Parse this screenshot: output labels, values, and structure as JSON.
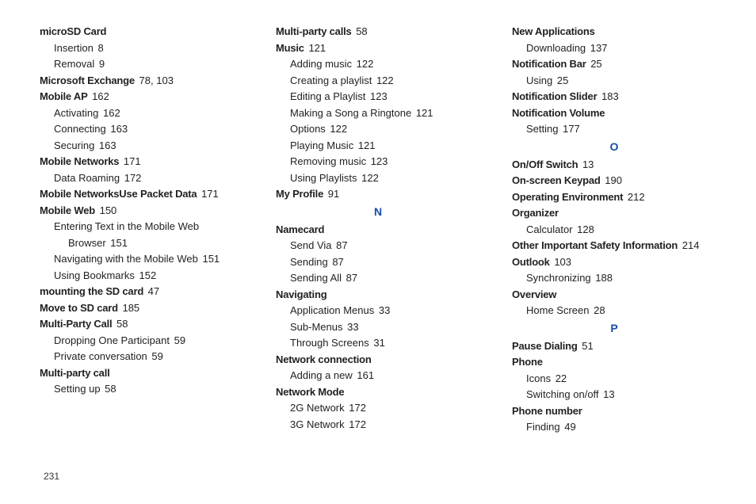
{
  "page_number": "231",
  "columns": [
    [
      {
        "type": "entry",
        "lvl": 0,
        "bold": true,
        "text": "microSD Card",
        "page": ""
      },
      {
        "type": "entry",
        "lvl": 1,
        "bold": false,
        "text": "Insertion",
        "page": "8"
      },
      {
        "type": "entry",
        "lvl": 1,
        "bold": false,
        "text": "Removal",
        "page": "9"
      },
      {
        "type": "entry",
        "lvl": 0,
        "bold": true,
        "text": "Microsoft Exchange",
        "page": "78, 103"
      },
      {
        "type": "entry",
        "lvl": 0,
        "bold": true,
        "text": "Mobile AP",
        "page": "162"
      },
      {
        "type": "entry",
        "lvl": 1,
        "bold": false,
        "text": "Activating",
        "page": "162"
      },
      {
        "type": "entry",
        "lvl": 1,
        "bold": false,
        "text": "Connecting",
        "page": "163"
      },
      {
        "type": "entry",
        "lvl": 1,
        "bold": false,
        "text": "Securing",
        "page": "163"
      },
      {
        "type": "entry",
        "lvl": 0,
        "bold": true,
        "text": "Mobile Networks",
        "page": "171"
      },
      {
        "type": "entry",
        "lvl": 1,
        "bold": false,
        "text": "Data Roaming",
        "page": "172"
      },
      {
        "type": "entry",
        "lvl": 0,
        "bold": true,
        "text": "Mobile NetworksUse Packet Data",
        "page": "171"
      },
      {
        "type": "entry",
        "lvl": 0,
        "bold": true,
        "text": "Mobile Web",
        "page": "150"
      },
      {
        "type": "entry",
        "lvl": 1,
        "bold": false,
        "text": "Entering Text in the Mobile Web",
        "page": ""
      },
      {
        "type": "entry",
        "lvl": 2,
        "bold": false,
        "text": "Browser",
        "page": "151"
      },
      {
        "type": "entry",
        "lvl": 1,
        "bold": false,
        "text": "Navigating with the Mobile Web",
        "page": "151"
      },
      {
        "type": "entry",
        "lvl": 1,
        "bold": false,
        "text": "Using Bookmarks",
        "page": "152"
      },
      {
        "type": "entry",
        "lvl": 0,
        "bold": true,
        "text": "mounting the SD card",
        "page": "47"
      },
      {
        "type": "entry",
        "lvl": 0,
        "bold": true,
        "text": "Move to SD card",
        "page": "185"
      },
      {
        "type": "entry",
        "lvl": 0,
        "bold": true,
        "text": "Multi-Party Call",
        "page": "58"
      },
      {
        "type": "entry",
        "lvl": 1,
        "bold": false,
        "text": "Dropping One Participant",
        "page": "59"
      },
      {
        "type": "entry",
        "lvl": 1,
        "bold": false,
        "text": "Private conversation",
        "page": "59"
      },
      {
        "type": "entry",
        "lvl": 0,
        "bold": true,
        "text": "Multi-party call",
        "page": ""
      },
      {
        "type": "entry",
        "lvl": 1,
        "bold": false,
        "text": "Setting up",
        "page": "58"
      }
    ],
    [
      {
        "type": "entry",
        "lvl": 0,
        "bold": true,
        "text": "Multi-party calls",
        "page": "58"
      },
      {
        "type": "entry",
        "lvl": 0,
        "bold": true,
        "text": "Music",
        "page": "121"
      },
      {
        "type": "entry",
        "lvl": 1,
        "bold": false,
        "text": "Adding music",
        "page": "122"
      },
      {
        "type": "entry",
        "lvl": 1,
        "bold": false,
        "text": "Creating a playlist",
        "page": "122"
      },
      {
        "type": "entry",
        "lvl": 1,
        "bold": false,
        "text": "Editing a Playlist",
        "page": "123"
      },
      {
        "type": "entry",
        "lvl": 1,
        "bold": false,
        "text": "Making a Song a Ringtone",
        "page": "121"
      },
      {
        "type": "entry",
        "lvl": 1,
        "bold": false,
        "text": "Options",
        "page": "122"
      },
      {
        "type": "entry",
        "lvl": 1,
        "bold": false,
        "text": "Playing Music",
        "page": "121"
      },
      {
        "type": "entry",
        "lvl": 1,
        "bold": false,
        "text": "Removing music",
        "page": "123"
      },
      {
        "type": "entry",
        "lvl": 1,
        "bold": false,
        "text": "Using Playlists",
        "page": "122"
      },
      {
        "type": "entry",
        "lvl": 0,
        "bold": true,
        "text": "My Profile",
        "page": "91"
      },
      {
        "type": "letter",
        "text": "N"
      },
      {
        "type": "entry",
        "lvl": 0,
        "bold": true,
        "text": "Namecard",
        "page": ""
      },
      {
        "type": "entry",
        "lvl": 1,
        "bold": false,
        "text": "Send Via",
        "page": "87"
      },
      {
        "type": "entry",
        "lvl": 1,
        "bold": false,
        "text": "Sending",
        "page": "87"
      },
      {
        "type": "entry",
        "lvl": 1,
        "bold": false,
        "text": "Sending All",
        "page": "87"
      },
      {
        "type": "entry",
        "lvl": 0,
        "bold": true,
        "text": "Navigating",
        "page": ""
      },
      {
        "type": "entry",
        "lvl": 1,
        "bold": false,
        "text": "Application Menus",
        "page": "33"
      },
      {
        "type": "entry",
        "lvl": 1,
        "bold": false,
        "text": "Sub-Menus",
        "page": "33"
      },
      {
        "type": "entry",
        "lvl": 1,
        "bold": false,
        "text": "Through Screens",
        "page": "31"
      },
      {
        "type": "entry",
        "lvl": 0,
        "bold": true,
        "text": "Network connection",
        "page": ""
      },
      {
        "type": "entry",
        "lvl": 1,
        "bold": false,
        "text": "Adding a new",
        "page": "161"
      },
      {
        "type": "entry",
        "lvl": 0,
        "bold": true,
        "text": "Network Mode",
        "page": ""
      },
      {
        "type": "entry",
        "lvl": 1,
        "bold": false,
        "text": "2G Network",
        "page": "172"
      },
      {
        "type": "entry",
        "lvl": 1,
        "bold": false,
        "text": "3G Network",
        "page": "172"
      }
    ],
    [
      {
        "type": "entry",
        "lvl": 0,
        "bold": true,
        "text": "New Applications",
        "page": ""
      },
      {
        "type": "entry",
        "lvl": 1,
        "bold": false,
        "text": "Downloading",
        "page": "137"
      },
      {
        "type": "entry",
        "lvl": 0,
        "bold": true,
        "text": "Notification Bar",
        "page": "25"
      },
      {
        "type": "entry",
        "lvl": 1,
        "bold": false,
        "text": "Using",
        "page": "25"
      },
      {
        "type": "entry",
        "lvl": 0,
        "bold": true,
        "text": "Notification Slider",
        "page": "183"
      },
      {
        "type": "entry",
        "lvl": 0,
        "bold": true,
        "text": "Notification Volume",
        "page": ""
      },
      {
        "type": "entry",
        "lvl": 1,
        "bold": false,
        "text": "Setting",
        "page": "177"
      },
      {
        "type": "letter",
        "text": "O"
      },
      {
        "type": "entry",
        "lvl": 0,
        "bold": true,
        "text": "On/Off Switch",
        "page": "13"
      },
      {
        "type": "entry",
        "lvl": 0,
        "bold": true,
        "text": "On-screen Keypad",
        "page": "190"
      },
      {
        "type": "entry",
        "lvl": 0,
        "bold": true,
        "text": "Operating Environment",
        "page": "212"
      },
      {
        "type": "entry",
        "lvl": 0,
        "bold": true,
        "text": "Organizer",
        "page": ""
      },
      {
        "type": "entry",
        "lvl": 1,
        "bold": false,
        "text": "Calculator",
        "page": "128"
      },
      {
        "type": "entry",
        "lvl": 0,
        "bold": true,
        "text": "Other Important Safety Information",
        "page": "214"
      },
      {
        "type": "entry",
        "lvl": 0,
        "bold": true,
        "text": "Outlook",
        "page": "103"
      },
      {
        "type": "entry",
        "lvl": 1,
        "bold": false,
        "text": "Synchronizing",
        "page": "188"
      },
      {
        "type": "entry",
        "lvl": 0,
        "bold": true,
        "text": "Overview",
        "page": ""
      },
      {
        "type": "entry",
        "lvl": 1,
        "bold": false,
        "text": "Home Screen",
        "page": "28"
      },
      {
        "type": "letter",
        "text": "P"
      },
      {
        "type": "entry",
        "lvl": 0,
        "bold": true,
        "text": "Pause Dialing",
        "page": "51"
      },
      {
        "type": "entry",
        "lvl": 0,
        "bold": true,
        "text": "Phone",
        "page": ""
      },
      {
        "type": "entry",
        "lvl": 1,
        "bold": false,
        "text": "Icons",
        "page": "22"
      },
      {
        "type": "entry",
        "lvl": 1,
        "bold": false,
        "text": "Switching on/off",
        "page": "13"
      },
      {
        "type": "entry",
        "lvl": 0,
        "bold": true,
        "text": "Phone number",
        "page": ""
      },
      {
        "type": "entry",
        "lvl": 1,
        "bold": false,
        "text": "Finding",
        "page": "49"
      }
    ]
  ]
}
